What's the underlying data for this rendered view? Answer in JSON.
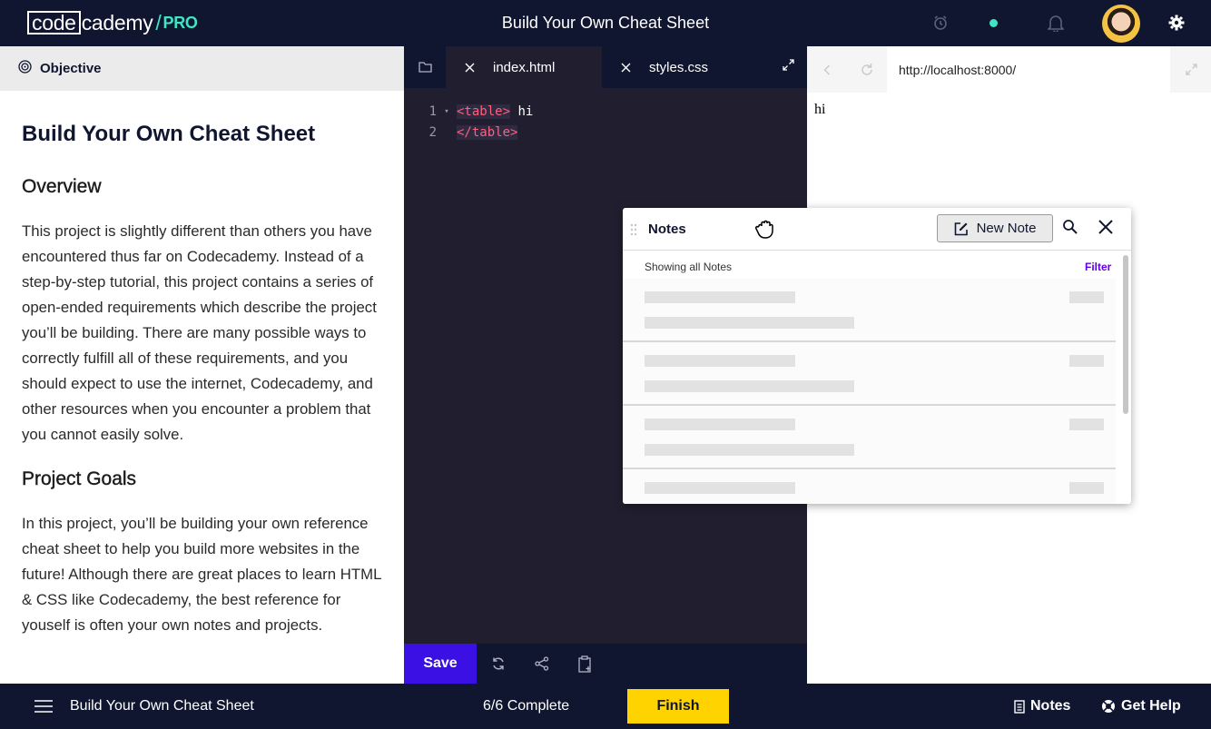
{
  "header": {
    "logo_code": "code",
    "logo_rest": "cademy",
    "logo_slash": "/",
    "logo_pro": "PRO",
    "title": "Build Your Own Cheat Sheet"
  },
  "objective": {
    "header_label": "Objective",
    "title": "Build Your Own Cheat Sheet",
    "overview_heading": "Overview",
    "overview_text": "This project is slightly different than others you have encountered thus far on Codecademy. Instead of a step-by-step tutorial, this project contains a series of open-ended requirements which describe the project you’ll be building. There are many possible ways to correctly fulfill all of these requirements, and you should expect to use the internet, Codecademy, and other resources when you encounter a problem that you cannot easily solve.",
    "goals_heading": "Project Goals",
    "goals_text": "In this project, you’ll be building your own reference cheat sheet to help you build more websites in the future! Although there are great places to learn HTML & CSS like Codecademy, the best reference for youself is often your own notes and projects."
  },
  "editor": {
    "tabs": [
      {
        "label": "index.html",
        "active": true
      },
      {
        "label": "styles.css",
        "active": false
      }
    ],
    "lines": [
      {
        "num": "1",
        "tag": "<table>",
        "text": " hi"
      },
      {
        "num": "2",
        "tag": "</table>",
        "text": ""
      }
    ],
    "fold_marker": "▾",
    "save_label": "Save"
  },
  "browser": {
    "url": "http://localhost:8000/",
    "content": "hi"
  },
  "notes": {
    "title": "Notes",
    "new_note_label": "New Note",
    "showing_label": "Showing all Notes",
    "filter_label": "Filter"
  },
  "footer": {
    "title": "Build Your Own Cheat Sheet",
    "progress": "6/6 Complete",
    "finish_label": "Finish",
    "notes_label": "Notes",
    "help_label": "Get Help"
  },
  "colors": {
    "navy": "#10162f",
    "editor_bg": "#211e2f",
    "accent_teal": "#3fe5c4",
    "save_purple": "#3a10e5",
    "finish_yellow": "#ffd300",
    "filter_purple": "#6400e4",
    "tag_pink": "#ff5f83"
  },
  "icons": [
    "alarm-clock-icon",
    "bell-icon",
    "gear-icon",
    "target-icon",
    "folder-icon",
    "close-icon",
    "expand-icon",
    "back-arrow-icon",
    "refresh-icon",
    "refresh-sync-icon",
    "share-icon",
    "clipboard-add-icon",
    "drag-handle-icon",
    "grab-hand-icon",
    "edit-icon",
    "search-icon",
    "hamburger-icon",
    "notes-doc-icon",
    "help-lifebuoy-icon"
  ]
}
